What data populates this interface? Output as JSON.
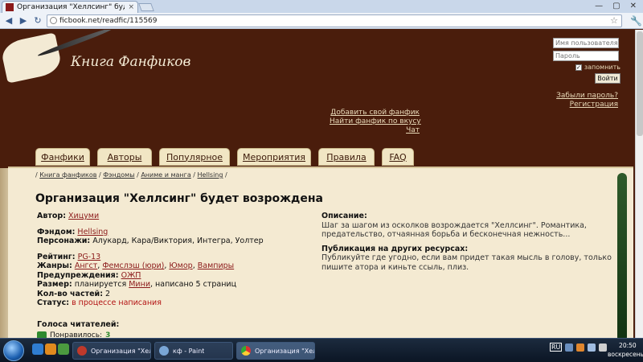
{
  "browser": {
    "tab_title": "Организация \"Хеллсинг\" буд",
    "tab_close": "×",
    "url": "ficbook.net/readfic/115569",
    "star": "☆",
    "wrench": "🔧",
    "back": "◀",
    "forward": "▶",
    "reload": "↻",
    "min": "—",
    "max": "▢",
    "close": "✕"
  },
  "site": {
    "logo_text": "Книга Фанфиков",
    "login": {
      "username_placeholder": "Имя пользователя",
      "password_placeholder": "Пароль",
      "remember_label": "запомнить",
      "remember_checked": "✓",
      "login_button": "Войти",
      "forgot_password": "Забыли пароль?",
      "register": "Регистрация"
    },
    "top_links": [
      "Добавить свой фанфик",
      "Найти фанфик по вкусу",
      "Чат"
    ],
    "menu": [
      "Фанфики",
      "Авторы",
      "Популярное",
      "Мероприятия",
      "Правила",
      "FAQ"
    ]
  },
  "breadcrumb": [
    "Книга фанфиков",
    "Фэндомы",
    "Аниме и манга",
    "Hellsing"
  ],
  "fic": {
    "title": "Организация \"Хеллсинг\" будет возрождена",
    "author_label": "Автор:",
    "author": "Хицуми",
    "fandom_label": "Фэндом:",
    "fandom": "Hellsing",
    "characters_label": "Персонажи:",
    "characters": "Алукард, Кара/Виктория, Интегра, Уолтер",
    "rating_label": "Рейтинг:",
    "rating": "PG-13",
    "genres_label": "Жанры:",
    "genres": [
      "Ангст",
      "Фемслэш (юри)",
      "Юмор",
      "Вампиры"
    ],
    "warnings_label": "Предупреждения:",
    "warnings": "ОЖП",
    "size_label": "Размер:",
    "size_pre": "планируется",
    "size_link": "Мини",
    "size_post": ", написано 5 страниц",
    "parts_label": "Кол-во частей:",
    "parts": "2",
    "status_label": "Статус:",
    "status": "в процессе написания",
    "description_label": "Описание:",
    "description": "Шаг за шагом из осколков возрождается \"Хеллсинг\". Романтика, предательство, отчаянная борьба и бесконечная нежность...",
    "publication_label": "Публикация на других ресурсах:",
    "publication": "Публикуйте где угодно, если вам придет такая мысль в голову, только пишите атора и киньте ссыль, плиз.",
    "votes_label": "Голоса читателей:",
    "liked_label": "Понравилось:",
    "liked_count": "3"
  },
  "taskbar": {
    "items": [
      "Организация \"Хеллс...",
      "кф - Paint",
      "Организация \"Хеллс..."
    ],
    "lang": "RU",
    "time": "20:50",
    "day": "воскресенье"
  }
}
